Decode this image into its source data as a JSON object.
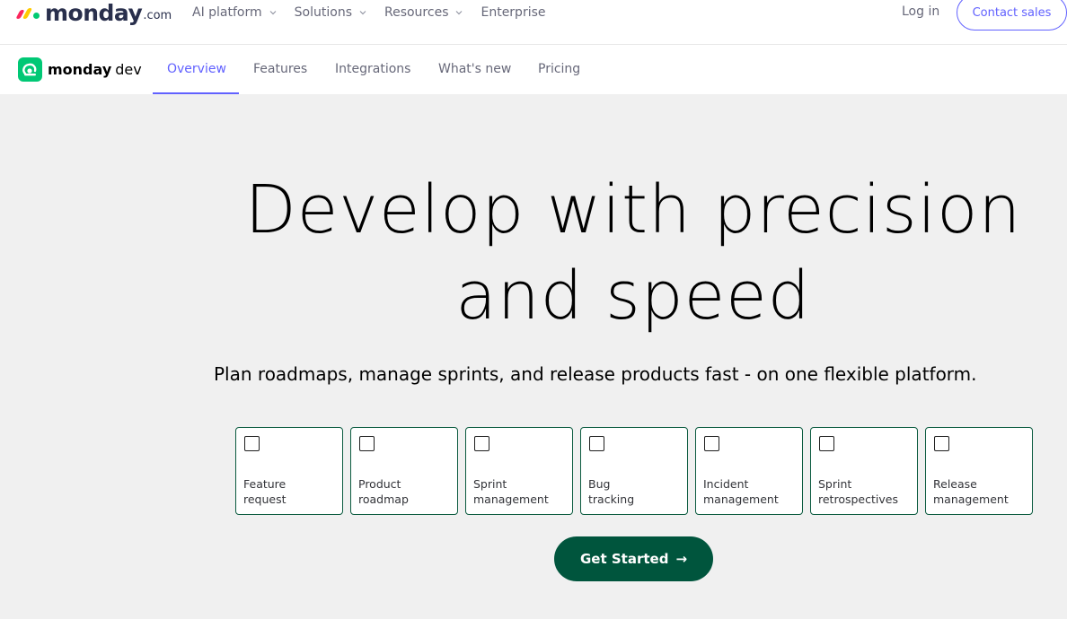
{
  "header": {
    "logo_text": "monday",
    "logo_suffix": ".com",
    "nav": [
      {
        "label": "AI platform",
        "has_dropdown": true
      },
      {
        "label": "Solutions",
        "has_dropdown": true
      },
      {
        "label": "Resources",
        "has_dropdown": true
      },
      {
        "label": "Enterprise",
        "has_dropdown": false
      }
    ],
    "login_label": "Log in",
    "contact_label": "Contact sales"
  },
  "subnav": {
    "brand": "monday",
    "brand_suffix": "dev",
    "items": [
      {
        "label": "Overview",
        "active": true
      },
      {
        "label": "Features",
        "active": false
      },
      {
        "label": "Integrations",
        "active": false
      },
      {
        "label": "What's new",
        "active": false
      },
      {
        "label": "Pricing",
        "active": false
      }
    ]
  },
  "hero": {
    "headline_line1": "Develop with precision",
    "headline_line2": "and speed",
    "subtitle": "Plan roadmaps, manage sprints, and release products fast - on one flexible platform.",
    "options": [
      {
        "line1": "Feature",
        "line2": "request",
        "checked": false
      },
      {
        "line1": "Product",
        "line2": "roadmap",
        "checked": false
      },
      {
        "line1": "Sprint",
        "line2": "management",
        "checked": false
      },
      {
        "line1": "Bug",
        "line2": "tracking",
        "checked": false
      },
      {
        "line1": "Incident",
        "line2": "management",
        "checked": false
      },
      {
        "line1": "Sprint",
        "line2": "retrospectives",
        "checked": false
      },
      {
        "line1": "Release",
        "line2": "management",
        "checked": false
      }
    ],
    "cta_label": "Get Started",
    "cta_arrow": "→"
  },
  "colors": {
    "accent": "#6161ff",
    "cta_bg": "#00553d",
    "card_border": "#0b5b3f",
    "dev_badge": "#00c875",
    "page_bg": "#f0f0f0"
  },
  "icons": {
    "logo_mark": "monday-logo-icon",
    "dev_badge": "monday-dev-icon",
    "dropdown": "chevron-down-icon",
    "cta_arrow": "arrow-right-icon"
  }
}
